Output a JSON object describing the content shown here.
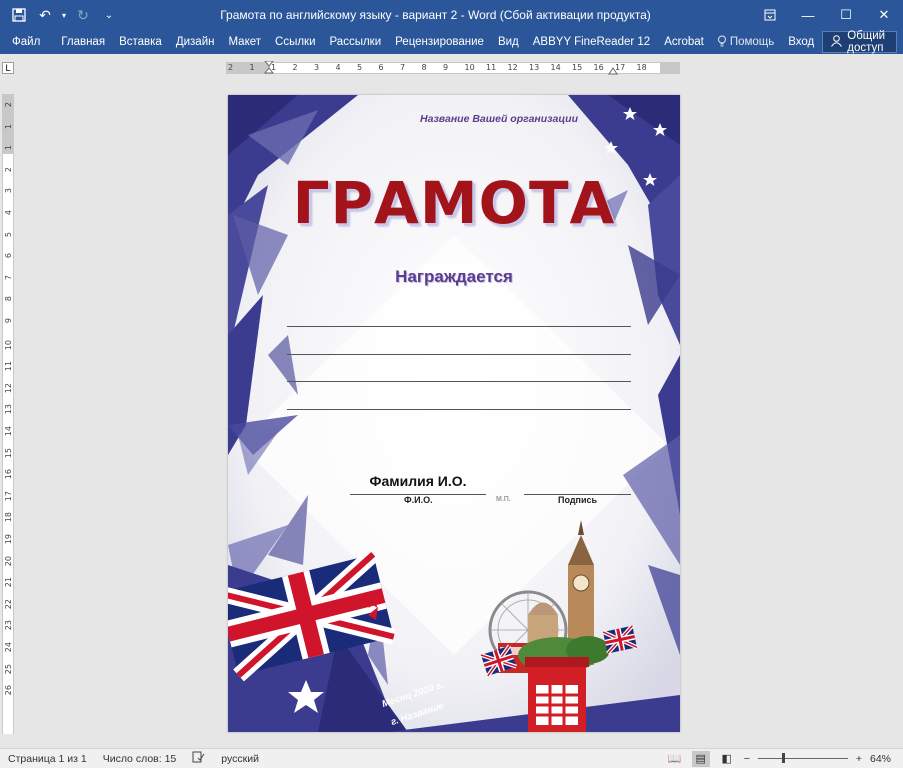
{
  "window": {
    "title": "Грамота по английскому языку - вариант 2 - Word (Сбой активации продукта)",
    "save_icon": "save-icon",
    "undo_icon": "undo-icon",
    "redo_icon": "redo-icon"
  },
  "ribbon": {
    "tabs": [
      "Файл",
      "Главная",
      "Вставка",
      "Дизайн",
      "Макет",
      "Ссылки",
      "Рассылки",
      "Рецензирование",
      "Вид",
      "ABBYY FineReader 12",
      "Acrobat"
    ],
    "help_label": "Помощь",
    "signin_label": "Вход",
    "share_label": "Общий доступ"
  },
  "ruler": {
    "h_numbers": [
      "2",
      "1",
      "1",
      "2",
      "3",
      "4",
      "5",
      "6",
      "7",
      "8",
      "9",
      "10",
      "11",
      "12",
      "13",
      "14",
      "15",
      "16",
      "17",
      "18"
    ],
    "v_numbers": [
      "2",
      "1",
      "1",
      "2",
      "3",
      "4",
      "5",
      "6",
      "7",
      "8",
      "9",
      "10",
      "11",
      "12",
      "13",
      "14",
      "15",
      "16",
      "17",
      "18",
      "19",
      "20",
      "21",
      "22",
      "23",
      "24",
      "25",
      "26"
    ]
  },
  "document": {
    "organization": "Название Вашей организации",
    "title": "ГРАМОТА",
    "awarded": "Награждается",
    "recipient": "Фамилия И.О.",
    "caption_fio": "Ф.И.О.",
    "caption_mp": "М.П.",
    "caption_signature": "Подпись",
    "footer_date": "Месяц 2020 г.",
    "footer_city": "г. Название"
  },
  "colors": {
    "ribbon": "#2b579a",
    "title_red": "#a3141a",
    "accent_purple": "#5a3d8e",
    "triangle_navy": "#3b3b8f"
  },
  "status": {
    "page": "Страница 1 из 1",
    "words": "Число слов: 15",
    "language": "русский",
    "zoom_percent": 64
  }
}
